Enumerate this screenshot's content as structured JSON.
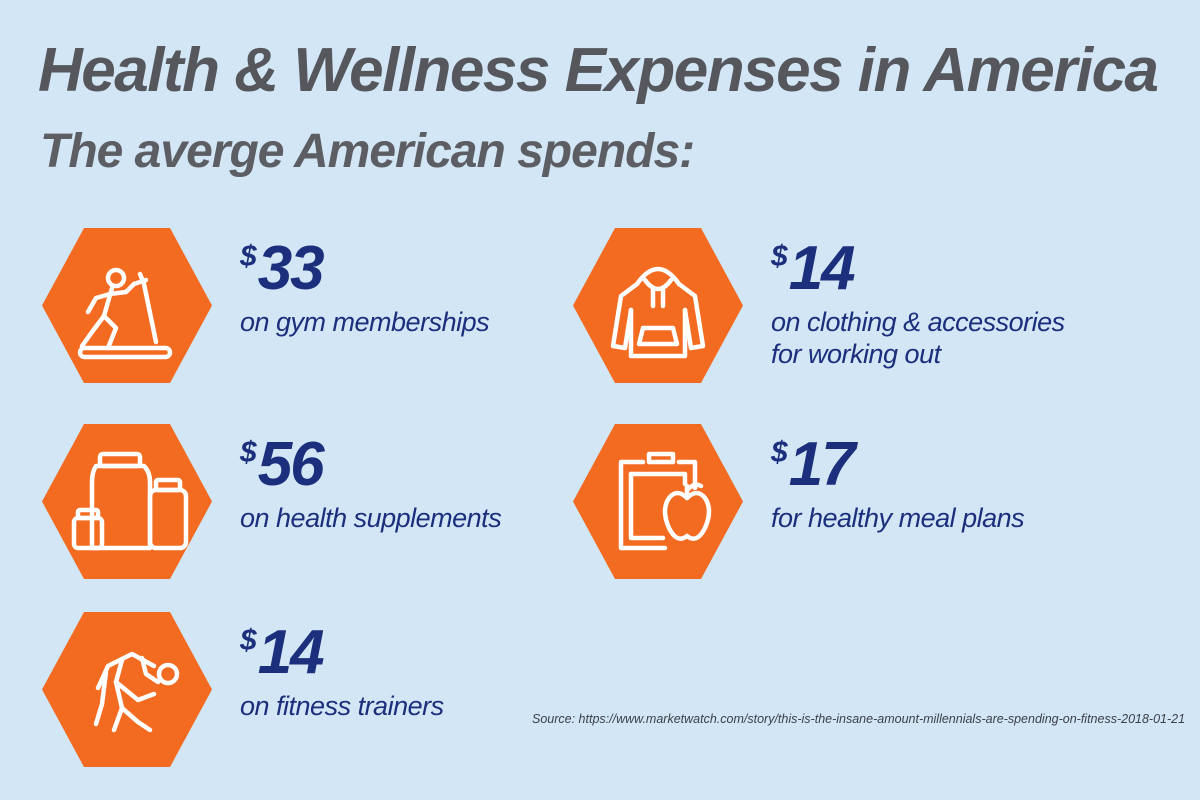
{
  "header": {
    "title": "Health & Wellness Expenses in America",
    "subtitle": "The averge American spends:"
  },
  "colors": {
    "background": "#d2e6f6",
    "hexagon": "#f26b21",
    "amount_text": "#1b2f7c",
    "title_text": "#55575c"
  },
  "stats": [
    {
      "currency": "$",
      "amount": "33",
      "line1": "on gym memberships",
      "line2": "",
      "icon": "treadmill-icon"
    },
    {
      "currency": "$",
      "amount": "14",
      "line1": "on clothing & accessories",
      "line2": "for working out",
      "icon": "hoodie-icon"
    },
    {
      "currency": "$",
      "amount": "56",
      "line1": "on health supplements",
      "line2": "",
      "icon": "supplement-jars-icon"
    },
    {
      "currency": "$",
      "amount": "17",
      "line1": "for healthy meal plans",
      "line2": "",
      "icon": "clipboard-apple-icon"
    },
    {
      "currency": "$",
      "amount": "14",
      "line1": "on fitness trainers",
      "line2": "",
      "icon": "trainer-stretch-icon"
    }
  ],
  "source": "Source: https://www.marketwatch.com/story/this-is-the-insane-amount-millennials-are-spending-on-fitness-2018-01-21"
}
